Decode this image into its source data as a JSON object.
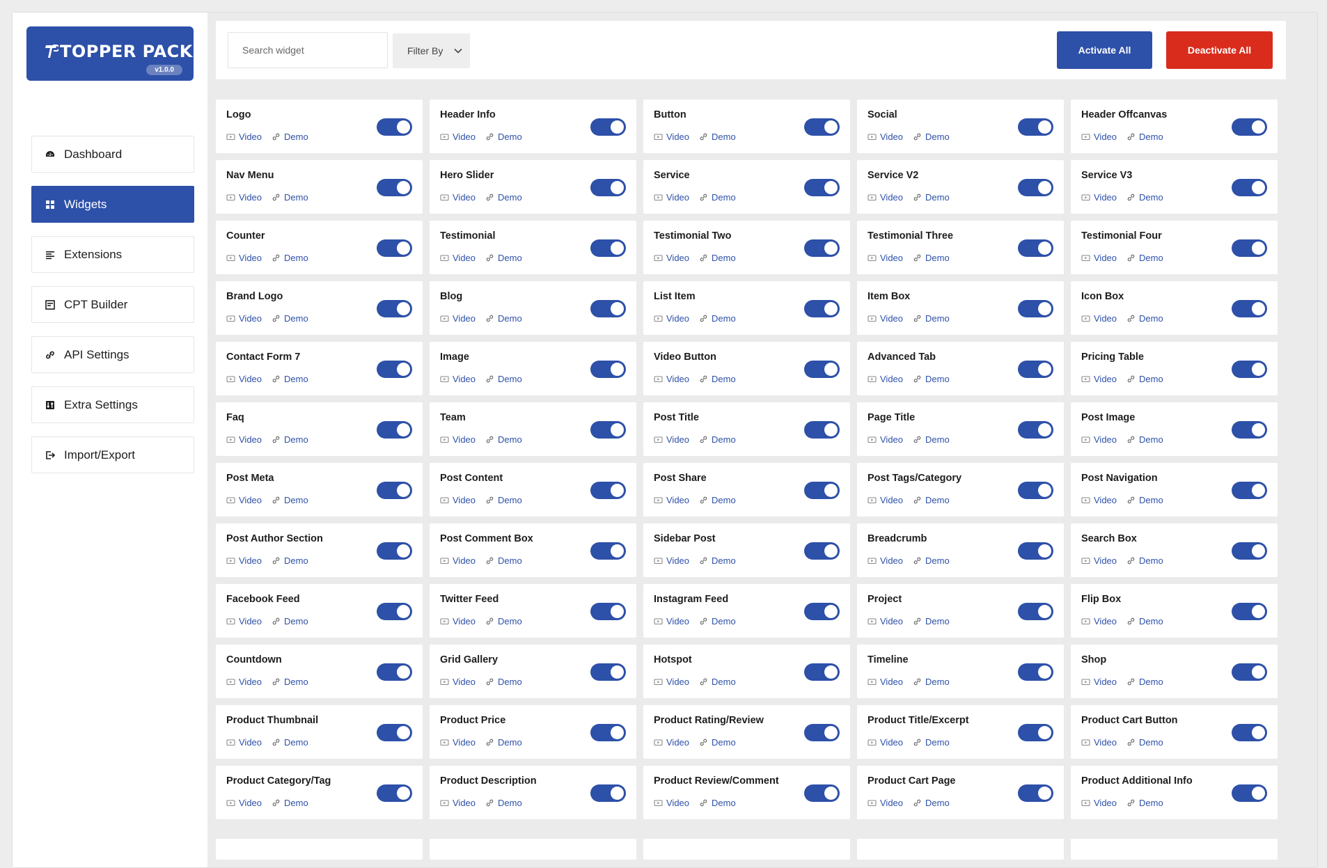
{
  "brand": {
    "name": "TOPPER PACK",
    "version": "v1.0.0",
    "accent": "#2d50a8",
    "danger": "#d92c1c"
  },
  "nav": [
    {
      "label": "Dashboard",
      "icon": "gauge-icon",
      "active": false
    },
    {
      "label": "Widgets",
      "icon": "grid-icon",
      "active": true
    },
    {
      "label": "Extensions",
      "icon": "list-icon",
      "active": false
    },
    {
      "label": "CPT Builder",
      "icon": "builder-icon",
      "active": false
    },
    {
      "label": "API Settings",
      "icon": "link-icon",
      "active": false
    },
    {
      "label": "Extra Settings",
      "icon": "settings-icon",
      "active": false
    },
    {
      "label": "Import/Export",
      "icon": "import-export-icon",
      "active": false
    }
  ],
  "toolbar": {
    "search_placeholder": "Search widget",
    "filter_label": "Filter By",
    "activate_all": "Activate All",
    "deactivate_all": "Deactivate All"
  },
  "link_labels": {
    "video": "Video",
    "demo": "Demo"
  },
  "widgets": [
    {
      "name": "Logo",
      "enabled": true
    },
    {
      "name": "Header Info",
      "enabled": true
    },
    {
      "name": "Button",
      "enabled": true
    },
    {
      "name": "Social",
      "enabled": true
    },
    {
      "name": "Header Offcanvas",
      "enabled": true
    },
    {
      "name": "Nav Menu",
      "enabled": true
    },
    {
      "name": "Hero Slider",
      "enabled": true
    },
    {
      "name": "Service",
      "enabled": true
    },
    {
      "name": "Service V2",
      "enabled": true
    },
    {
      "name": "Service V3",
      "enabled": true
    },
    {
      "name": "Counter",
      "enabled": true
    },
    {
      "name": "Testimonial",
      "enabled": true
    },
    {
      "name": "Testimonial Two",
      "enabled": true
    },
    {
      "name": "Testimonial Three",
      "enabled": true
    },
    {
      "name": "Testimonial Four",
      "enabled": true
    },
    {
      "name": "Brand Logo",
      "enabled": true
    },
    {
      "name": "Blog",
      "enabled": true
    },
    {
      "name": "List Item",
      "enabled": true
    },
    {
      "name": "Item Box",
      "enabled": true
    },
    {
      "name": "Icon Box",
      "enabled": true
    },
    {
      "name": "Contact Form 7",
      "enabled": true
    },
    {
      "name": "Image",
      "enabled": true
    },
    {
      "name": "Video Button",
      "enabled": true
    },
    {
      "name": "Advanced Tab",
      "enabled": true
    },
    {
      "name": "Pricing Table",
      "enabled": true
    },
    {
      "name": "Faq",
      "enabled": true
    },
    {
      "name": "Team",
      "enabled": true
    },
    {
      "name": "Post Title",
      "enabled": true
    },
    {
      "name": "Page Title",
      "enabled": true
    },
    {
      "name": "Post Image",
      "enabled": true
    },
    {
      "name": "Post Meta",
      "enabled": true
    },
    {
      "name": "Post Content",
      "enabled": true
    },
    {
      "name": "Post Share",
      "enabled": true
    },
    {
      "name": "Post Tags/Category",
      "enabled": true
    },
    {
      "name": "Post Navigation",
      "enabled": true
    },
    {
      "name": "Post Author Section",
      "enabled": true
    },
    {
      "name": "Post Comment Box",
      "enabled": true
    },
    {
      "name": "Sidebar Post",
      "enabled": true
    },
    {
      "name": "Breadcrumb",
      "enabled": true
    },
    {
      "name": "Search Box",
      "enabled": true
    },
    {
      "name": "Facebook Feed",
      "enabled": true
    },
    {
      "name": "Twitter Feed",
      "enabled": true
    },
    {
      "name": "Instagram Feed",
      "enabled": true
    },
    {
      "name": "Project",
      "enabled": true
    },
    {
      "name": "Flip Box",
      "enabled": true
    },
    {
      "name": "Countdown",
      "enabled": true
    },
    {
      "name": "Grid Gallery",
      "enabled": true
    },
    {
      "name": "Hotspot",
      "enabled": true
    },
    {
      "name": "Timeline",
      "enabled": true
    },
    {
      "name": "Shop",
      "enabled": true
    },
    {
      "name": "Product Thumbnail",
      "enabled": true
    },
    {
      "name": "Product Price",
      "enabled": true
    },
    {
      "name": "Product Rating/Review",
      "enabled": true
    },
    {
      "name": "Product Title/Excerpt",
      "enabled": true
    },
    {
      "name": "Product Cart Button",
      "enabled": true
    },
    {
      "name": "Product Category/Tag",
      "enabled": true
    },
    {
      "name": "Product Description",
      "enabled": true
    },
    {
      "name": "Product Review/Comment",
      "enabled": true
    },
    {
      "name": "Product Cart Page",
      "enabled": true
    },
    {
      "name": "Product Additional Info",
      "enabled": true
    }
  ]
}
